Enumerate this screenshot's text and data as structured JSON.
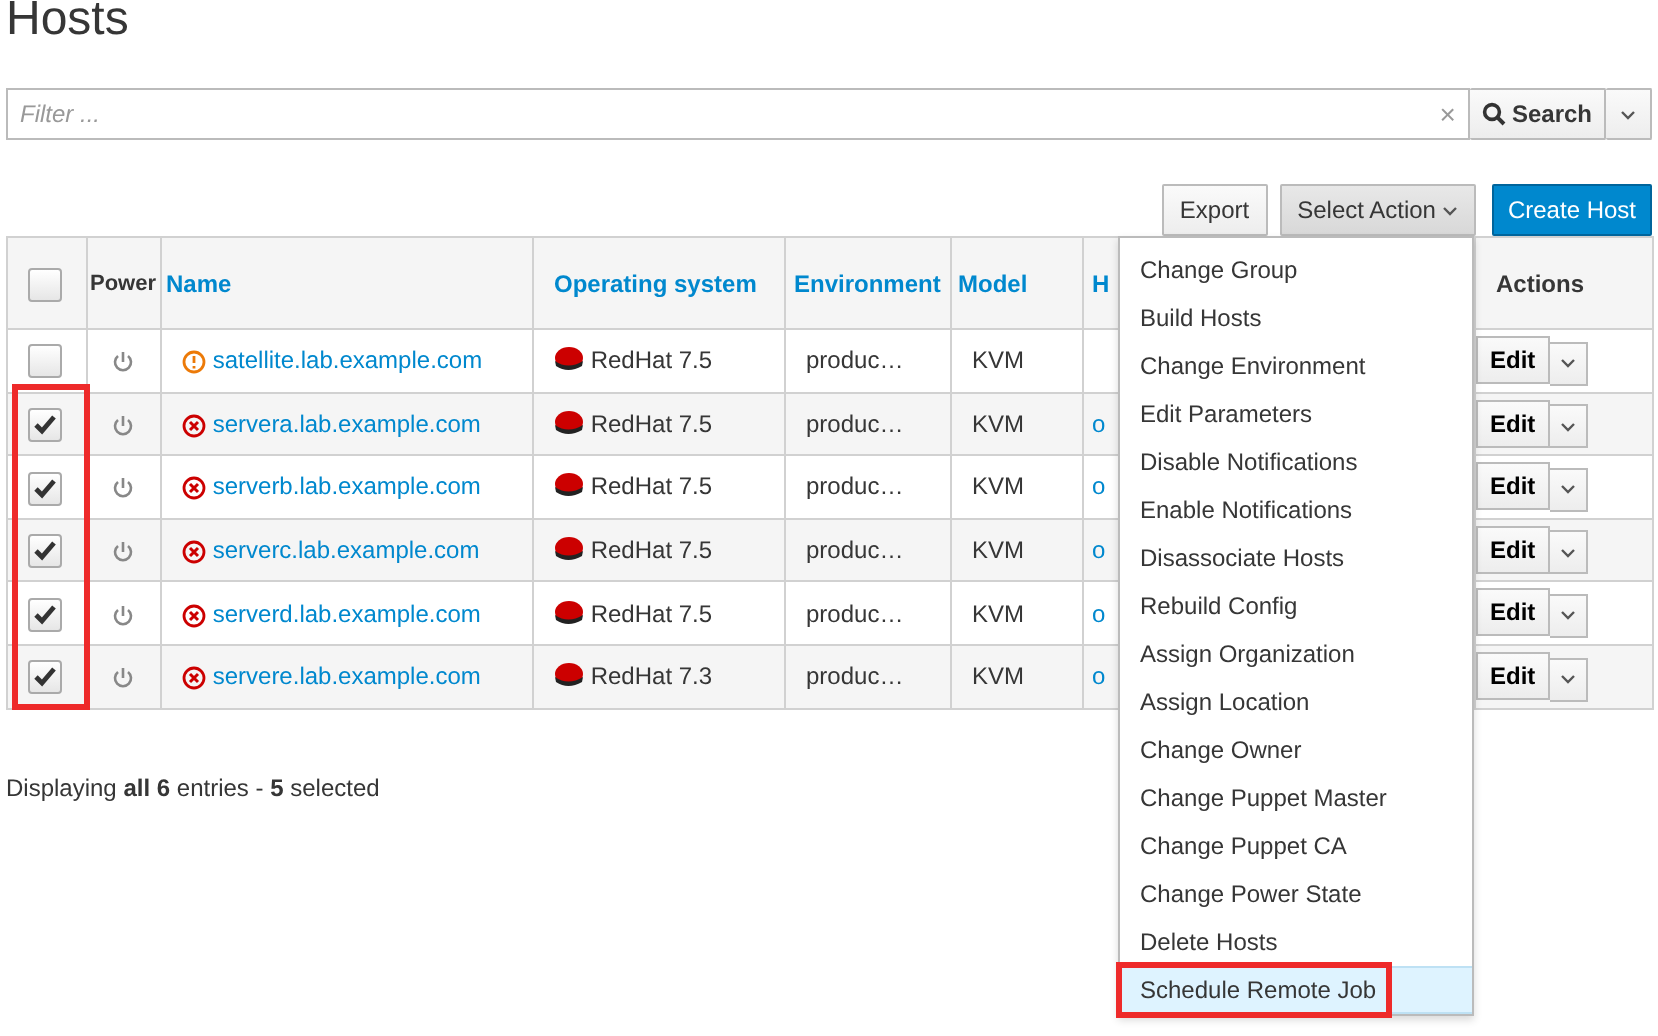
{
  "title": "Hosts",
  "filter": {
    "placeholder": "Filter ...",
    "clear": "×"
  },
  "search_button": "Search",
  "toolbar": {
    "export": "Export",
    "select_action": "Select Action",
    "create": "Create Host"
  },
  "table": {
    "select_all": {
      "checked": false
    },
    "columns": [
      "Power",
      "Name",
      "Operating system",
      "Environment",
      "Model",
      "H",
      "Actions"
    ],
    "rows": [
      {
        "checked": false,
        "kind": "warning",
        "name": "satellite.lab.example.com",
        "os": "RedHat 7.5",
        "environment": "produc…",
        "model": "KVM",
        "action": "Edit"
      },
      {
        "checked": true,
        "kind": "error",
        "name": "servera.lab.example.com",
        "os": "RedHat 7.5",
        "environment": "produc…",
        "model": "KVM",
        "column_7": "o",
        "action": "Edit"
      },
      {
        "checked": true,
        "kind": "error",
        "name": "serverb.lab.example.com",
        "os": "RedHat 7.5",
        "environment": "produc…",
        "model": "KVM",
        "column_7": "o",
        "action": "Edit"
      },
      {
        "checked": true,
        "kind": "error",
        "name": "serverc.lab.example.com",
        "os": "RedHat 7.5",
        "environment": "produc…",
        "model": "KVM",
        "column_7": "o",
        "action": "Edit"
      },
      {
        "checked": true,
        "kind": "error",
        "name": "serverd.lab.example.com",
        "os": "RedHat 7.5",
        "environment": "produc…",
        "model": "KVM",
        "column_7": "o",
        "action": "Edit"
      },
      {
        "checked": true,
        "kind": "error",
        "name": "servere.lab.example.com",
        "os": "RedHat 7.3",
        "environment": "produc…",
        "model": "KVM",
        "column_7": "o",
        "action": "Edit"
      }
    ],
    "checked_rows_framed": true
  },
  "footer": "Displaying **all 6** entries - **5** selected",
  "action_menu": {
    "open": true,
    "items": [
      {
        "label": "Change Group",
        "hovered": false,
        "framed": false
      },
      {
        "label": "Build Hosts",
        "hovered": false,
        "framed": false
      },
      {
        "label": "Change Environment",
        "hovered": false,
        "framed": false
      },
      {
        "label": "Edit Parameters",
        "hovered": false,
        "framed": false
      },
      {
        "label": "Disable Notifications",
        "hovered": false,
        "framed": false
      },
      {
        "label": "Enable Notifications",
        "hovered": false,
        "framed": false
      },
      {
        "label": "Disassociate Hosts",
        "hovered": false,
        "framed": false
      },
      {
        "label": "Rebuild Config",
        "hovered": false,
        "framed": false
      },
      {
        "label": "Assign Organization",
        "hovered": false,
        "framed": false
      },
      {
        "label": "Assign Location",
        "hovered": false,
        "framed": false
      },
      {
        "label": "Change Owner",
        "hovered": false,
        "framed": false
      },
      {
        "label": "Change Puppet Master",
        "hovered": false,
        "framed": false
      },
      {
        "label": "Change Puppet CA",
        "hovered": false,
        "framed": false
      },
      {
        "label": "Change Power State",
        "hovered": false,
        "framed": false
      },
      {
        "label": "Delete Hosts",
        "hovered": false,
        "framed": false
      },
      {
        "label": "Schedule Remote Job",
        "hovered": true,
        "framed": true
      }
    ]
  }
}
